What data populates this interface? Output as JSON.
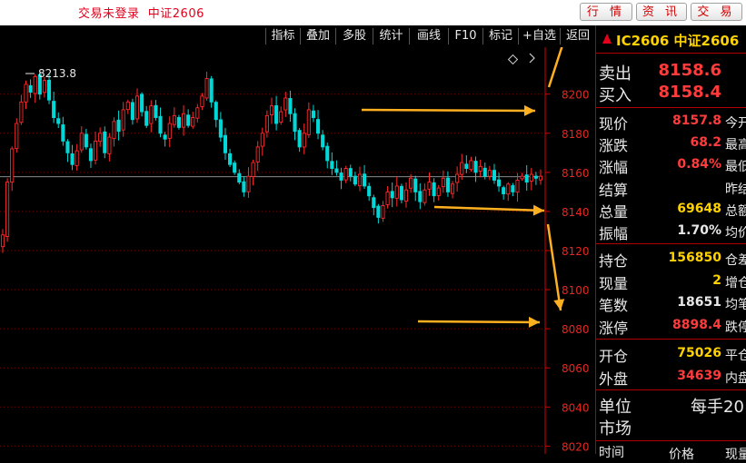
{
  "topbar": {
    "status": "交易未登录",
    "instrument": "中证2606",
    "buttons": [
      "行 情",
      "资 讯",
      "交 易"
    ]
  },
  "toolbar": {
    "items": [
      "指标",
      "叠加",
      "多股",
      "统计",
      "画线",
      "F10",
      "标记",
      "+自选",
      "返回"
    ]
  },
  "chart": {
    "high_label": "8213.8",
    "y_ticks": [
      "8200",
      "8180",
      "8160",
      "8140",
      "8120",
      "8100",
      "8080",
      "8060",
      "8040",
      "8020"
    ],
    "colors": {
      "up": "#ff2a2a",
      "down": "#00d8d8",
      "axis": "#d40000",
      "grid": "#7a0000",
      "arrow": "#ffb020"
    }
  },
  "chart_data": {
    "type": "candlestick",
    "title": "",
    "ylim": [
      8016,
      8224
    ],
    "high": 8213.8,
    "last": 8157.8,
    "closes": [
      8128,
      8155,
      8172,
      8185,
      8196,
      8205,
      8201,
      8209,
      8200,
      8207,
      8197,
      8188,
      8185,
      8176,
      8170,
      8164,
      8171,
      8180,
      8173,
      8166,
      8176,
      8180,
      8170,
      8178,
      8186,
      8181,
      8192,
      8196,
      8187,
      8199,
      8191,
      8184,
      8194,
      8188,
      8180,
      8177,
      8185,
      8189,
      8183,
      8190,
      8184,
      8188,
      8193,
      8199,
      8208,
      8196,
      8187,
      8178,
      8170,
      8164,
      8160,
      8155,
      8150,
      8158,
      8165,
      8173,
      8180,
      8189,
      8194,
      8185,
      8191,
      8198,
      8190,
      8181,
      8173,
      8180,
      8192,
      8188,
      8180,
      8173,
      8166,
      8162,
      8160,
      8156,
      8162,
      8158,
      8154,
      8159,
      8153,
      8148,
      8142,
      8137,
      8143,
      8150,
      8147,
      8153,
      8146,
      8151,
      8157,
      8150,
      8145,
      8151,
      8155,
      8148,
      8152,
      8157,
      8150,
      8154,
      8159,
      8165,
      8162,
      8166,
      8160,
      8163,
      8158,
      8161,
      8156,
      8153,
      8149,
      8154,
      8150,
      8156,
      8158,
      8155,
      8159,
      8157,
      8158
    ]
  },
  "quote": {
    "header": "IC2606 中证2606",
    "sell": {
      "label": "卖出",
      "value": "8158.6"
    },
    "buy": {
      "label": "买入",
      "value": "8158.4"
    },
    "rows1": [
      {
        "label": "现价",
        "value": "8157.8",
        "extra": "今开",
        "color": "red"
      },
      {
        "label": "涨跌",
        "value": "68.2",
        "extra": "最高",
        "color": "red"
      },
      {
        "label": "涨幅",
        "value": "0.84%",
        "extra": "最低",
        "color": "red"
      },
      {
        "label": "结算",
        "value": "",
        "extra": "昨结",
        "color": "white"
      },
      {
        "label": "总量",
        "value": "69648",
        "extra": "总额",
        "color": "yellow"
      },
      {
        "label": "振幅",
        "value": "1.70%",
        "extra": "均价",
        "color": "white"
      }
    ],
    "rows2": [
      {
        "label": "持仓",
        "value": "156850",
        "extra": "仓差",
        "color": "yellow"
      },
      {
        "label": "现量",
        "value": "2",
        "extra": "增仓",
        "color": "yellow"
      },
      {
        "label": "笔数",
        "value": "18651",
        "extra": "均笔",
        "color": "white"
      },
      {
        "label": "涨停",
        "value": "8898.4",
        "extra": "跌停",
        "color": "red"
      }
    ],
    "rows3": [
      {
        "label": "开仓",
        "value": "75026",
        "extra": "平仓",
        "color": "yellow"
      },
      {
        "label": "外盘",
        "value": "34639",
        "extra": "内盘",
        "color": "red"
      }
    ],
    "unit": {
      "label": "单位",
      "value": "每手20"
    },
    "market": {
      "label": "市场"
    },
    "footer": {
      "time": "时间",
      "price": "价格",
      "vol": "现量"
    }
  }
}
